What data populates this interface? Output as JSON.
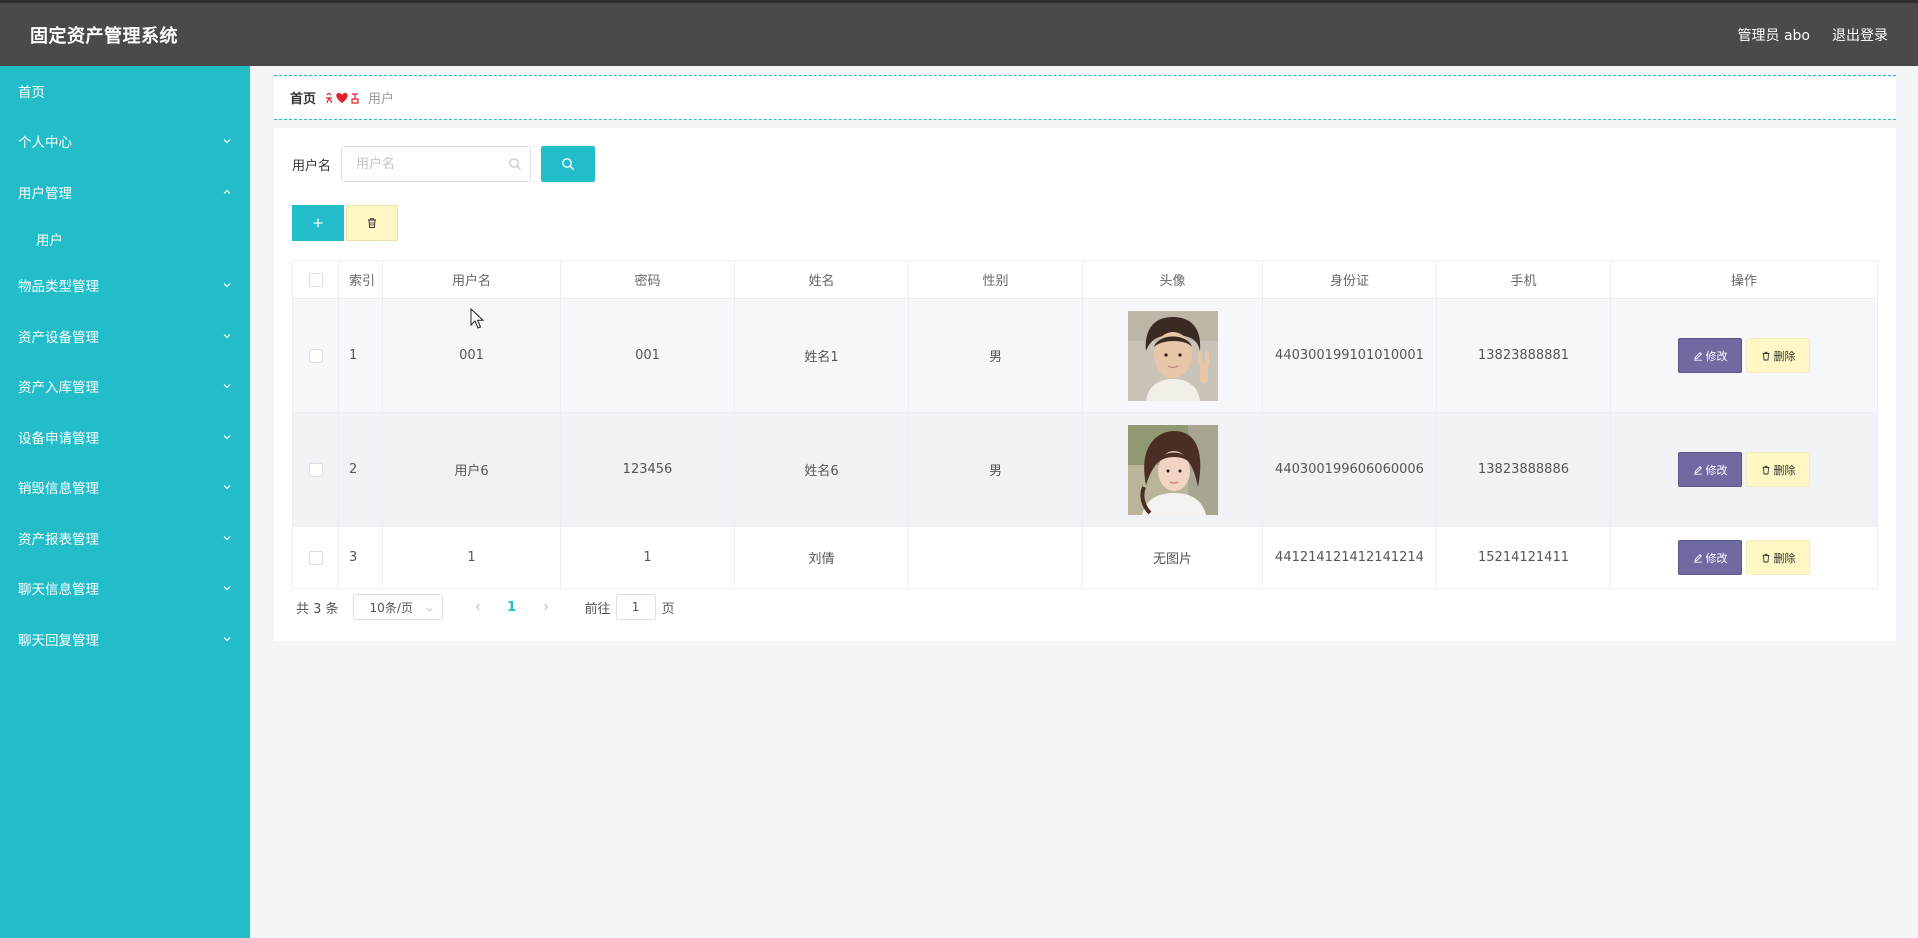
{
  "app": {
    "title": "固定资产管理系统",
    "user_label": "管理员 abo",
    "logout_label": "退出登录"
  },
  "sidebar": {
    "items": [
      {
        "label": "首页"
      },
      {
        "label": "个人中心"
      },
      {
        "label": "用户管理"
      },
      {
        "label": "用户"
      },
      {
        "label": "物品类型管理"
      },
      {
        "label": "资产设备管理"
      },
      {
        "label": "资产入库管理"
      },
      {
        "label": "设备申请管理"
      },
      {
        "label": "销毁信息管理"
      },
      {
        "label": "资产报表管理"
      },
      {
        "label": "聊天信息管理"
      },
      {
        "label": "聊天回复管理"
      }
    ]
  },
  "breadcrumb": {
    "home": "首页",
    "current": "用户"
  },
  "search": {
    "label": "用户名",
    "placeholder": "用户名",
    "value": ""
  },
  "table": {
    "headers": [
      "索引",
      "用户名",
      "密码",
      "姓名",
      "性别",
      "头像",
      "身份证",
      "手机",
      "操作"
    ],
    "rows": [
      {
        "index": "1",
        "username": "001",
        "password": "001",
        "name": "姓名1",
        "gender": "男",
        "avatar": "photo",
        "id_card": "440300199101010001",
        "phone": "13823888881"
      },
      {
        "index": "2",
        "username": "用户6",
        "password": "123456",
        "name": "姓名6",
        "gender": "男",
        "avatar": "photo",
        "id_card": "440300199606060006",
        "phone": "13823888886"
      },
      {
        "index": "3",
        "username": "1",
        "password": "1",
        "name": "刘倩",
        "gender": "",
        "avatar": "无图片",
        "id_card": "441214121412141214",
        "phone": "15214121411"
      }
    ],
    "edit_label": "修改",
    "delete_label": "删除"
  },
  "pagination": {
    "total": "共 3 条",
    "page_size": "10条/页",
    "current_page": "1",
    "goto_label": "前往",
    "goto_value": "1",
    "page_unit": "页"
  },
  "colors": {
    "accent": "#23bdca",
    "topbar": "#4a4a4a",
    "edit_button": "#6f6aa2",
    "delete_button": "#fff8c4"
  }
}
